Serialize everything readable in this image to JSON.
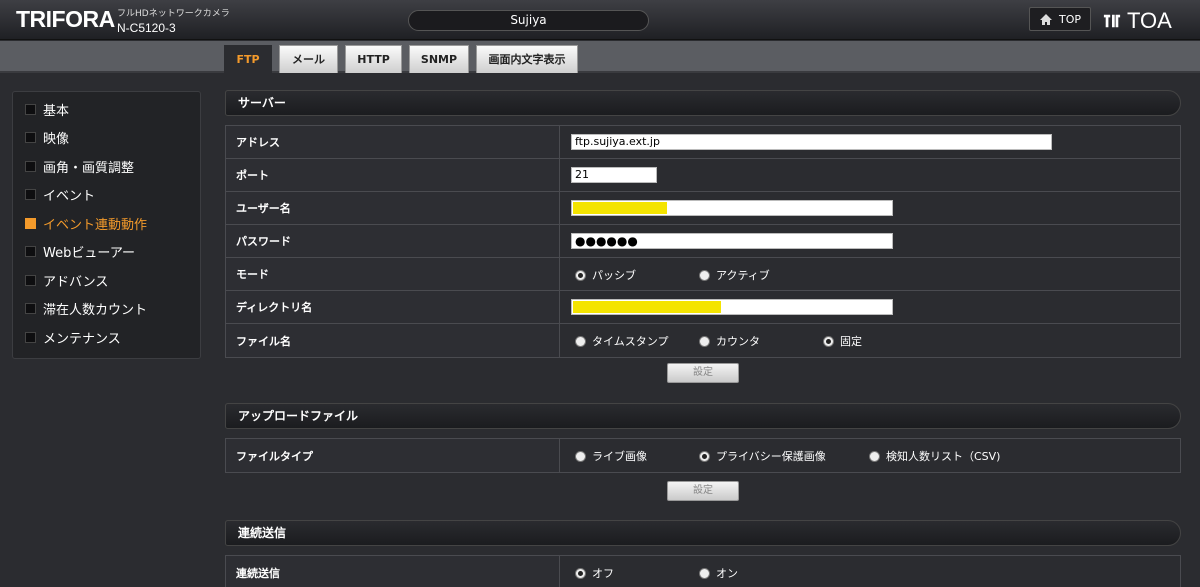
{
  "header": {
    "brand": "TRIFORA",
    "subtitle": "フルHDネットワークカメラ",
    "model": "N-C5120-3",
    "camera_name": "Sujiya",
    "top_label": "TOP",
    "top_icon": "home-icon",
    "logo_text": "TOA"
  },
  "tabs": [
    {
      "label": "FTP",
      "active": true
    },
    {
      "label": "メール",
      "active": false
    },
    {
      "label": "HTTP",
      "active": false
    },
    {
      "label": "SNMP",
      "active": false
    },
    {
      "label": "画面内文字表示",
      "active": false
    }
  ],
  "sidebar": {
    "items": [
      {
        "label": "基本",
        "active": false
      },
      {
        "label": "映像",
        "active": false
      },
      {
        "label": "画角・画質調整",
        "active": false
      },
      {
        "label": "イベント",
        "active": false
      },
      {
        "label": "イベント連動動作",
        "active": true
      },
      {
        "label": "Webビューアー",
        "active": false
      },
      {
        "label": "アドバンス",
        "active": false
      },
      {
        "label": "滞在人数カウント",
        "active": false
      },
      {
        "label": "メンテナンス",
        "active": false
      }
    ]
  },
  "server": {
    "title": "サーバー",
    "address_label": "アドレス",
    "address_value": "ftp.sujiya.ext.jp",
    "port_label": "ポート",
    "port_value": "21",
    "user_label": "ユーザー名",
    "password_label": "パスワード",
    "password_value": "●●●●●●",
    "mode_label": "モード",
    "mode_options": [
      "パッシブ",
      "アクティブ"
    ],
    "dir_label": "ディレクトリ名",
    "filename_label": "ファイル名",
    "filename_options": [
      "タイムスタンプ",
      "カウンタ",
      "固定"
    ],
    "set_label": "設定"
  },
  "upload": {
    "title": "アップロードファイル",
    "filetype_label": "ファイルタイプ",
    "filetype_options": [
      "ライブ画像",
      "プライバシー保護画像",
      "検知人数リスト（CSV)"
    ],
    "set_label": "設定"
  },
  "continuous": {
    "title": "連続送信",
    "label": "連続送信",
    "options": [
      "オフ",
      "オン"
    ]
  },
  "colors": {
    "accent": "#f39a2b",
    "redaction": "#f4e400"
  }
}
